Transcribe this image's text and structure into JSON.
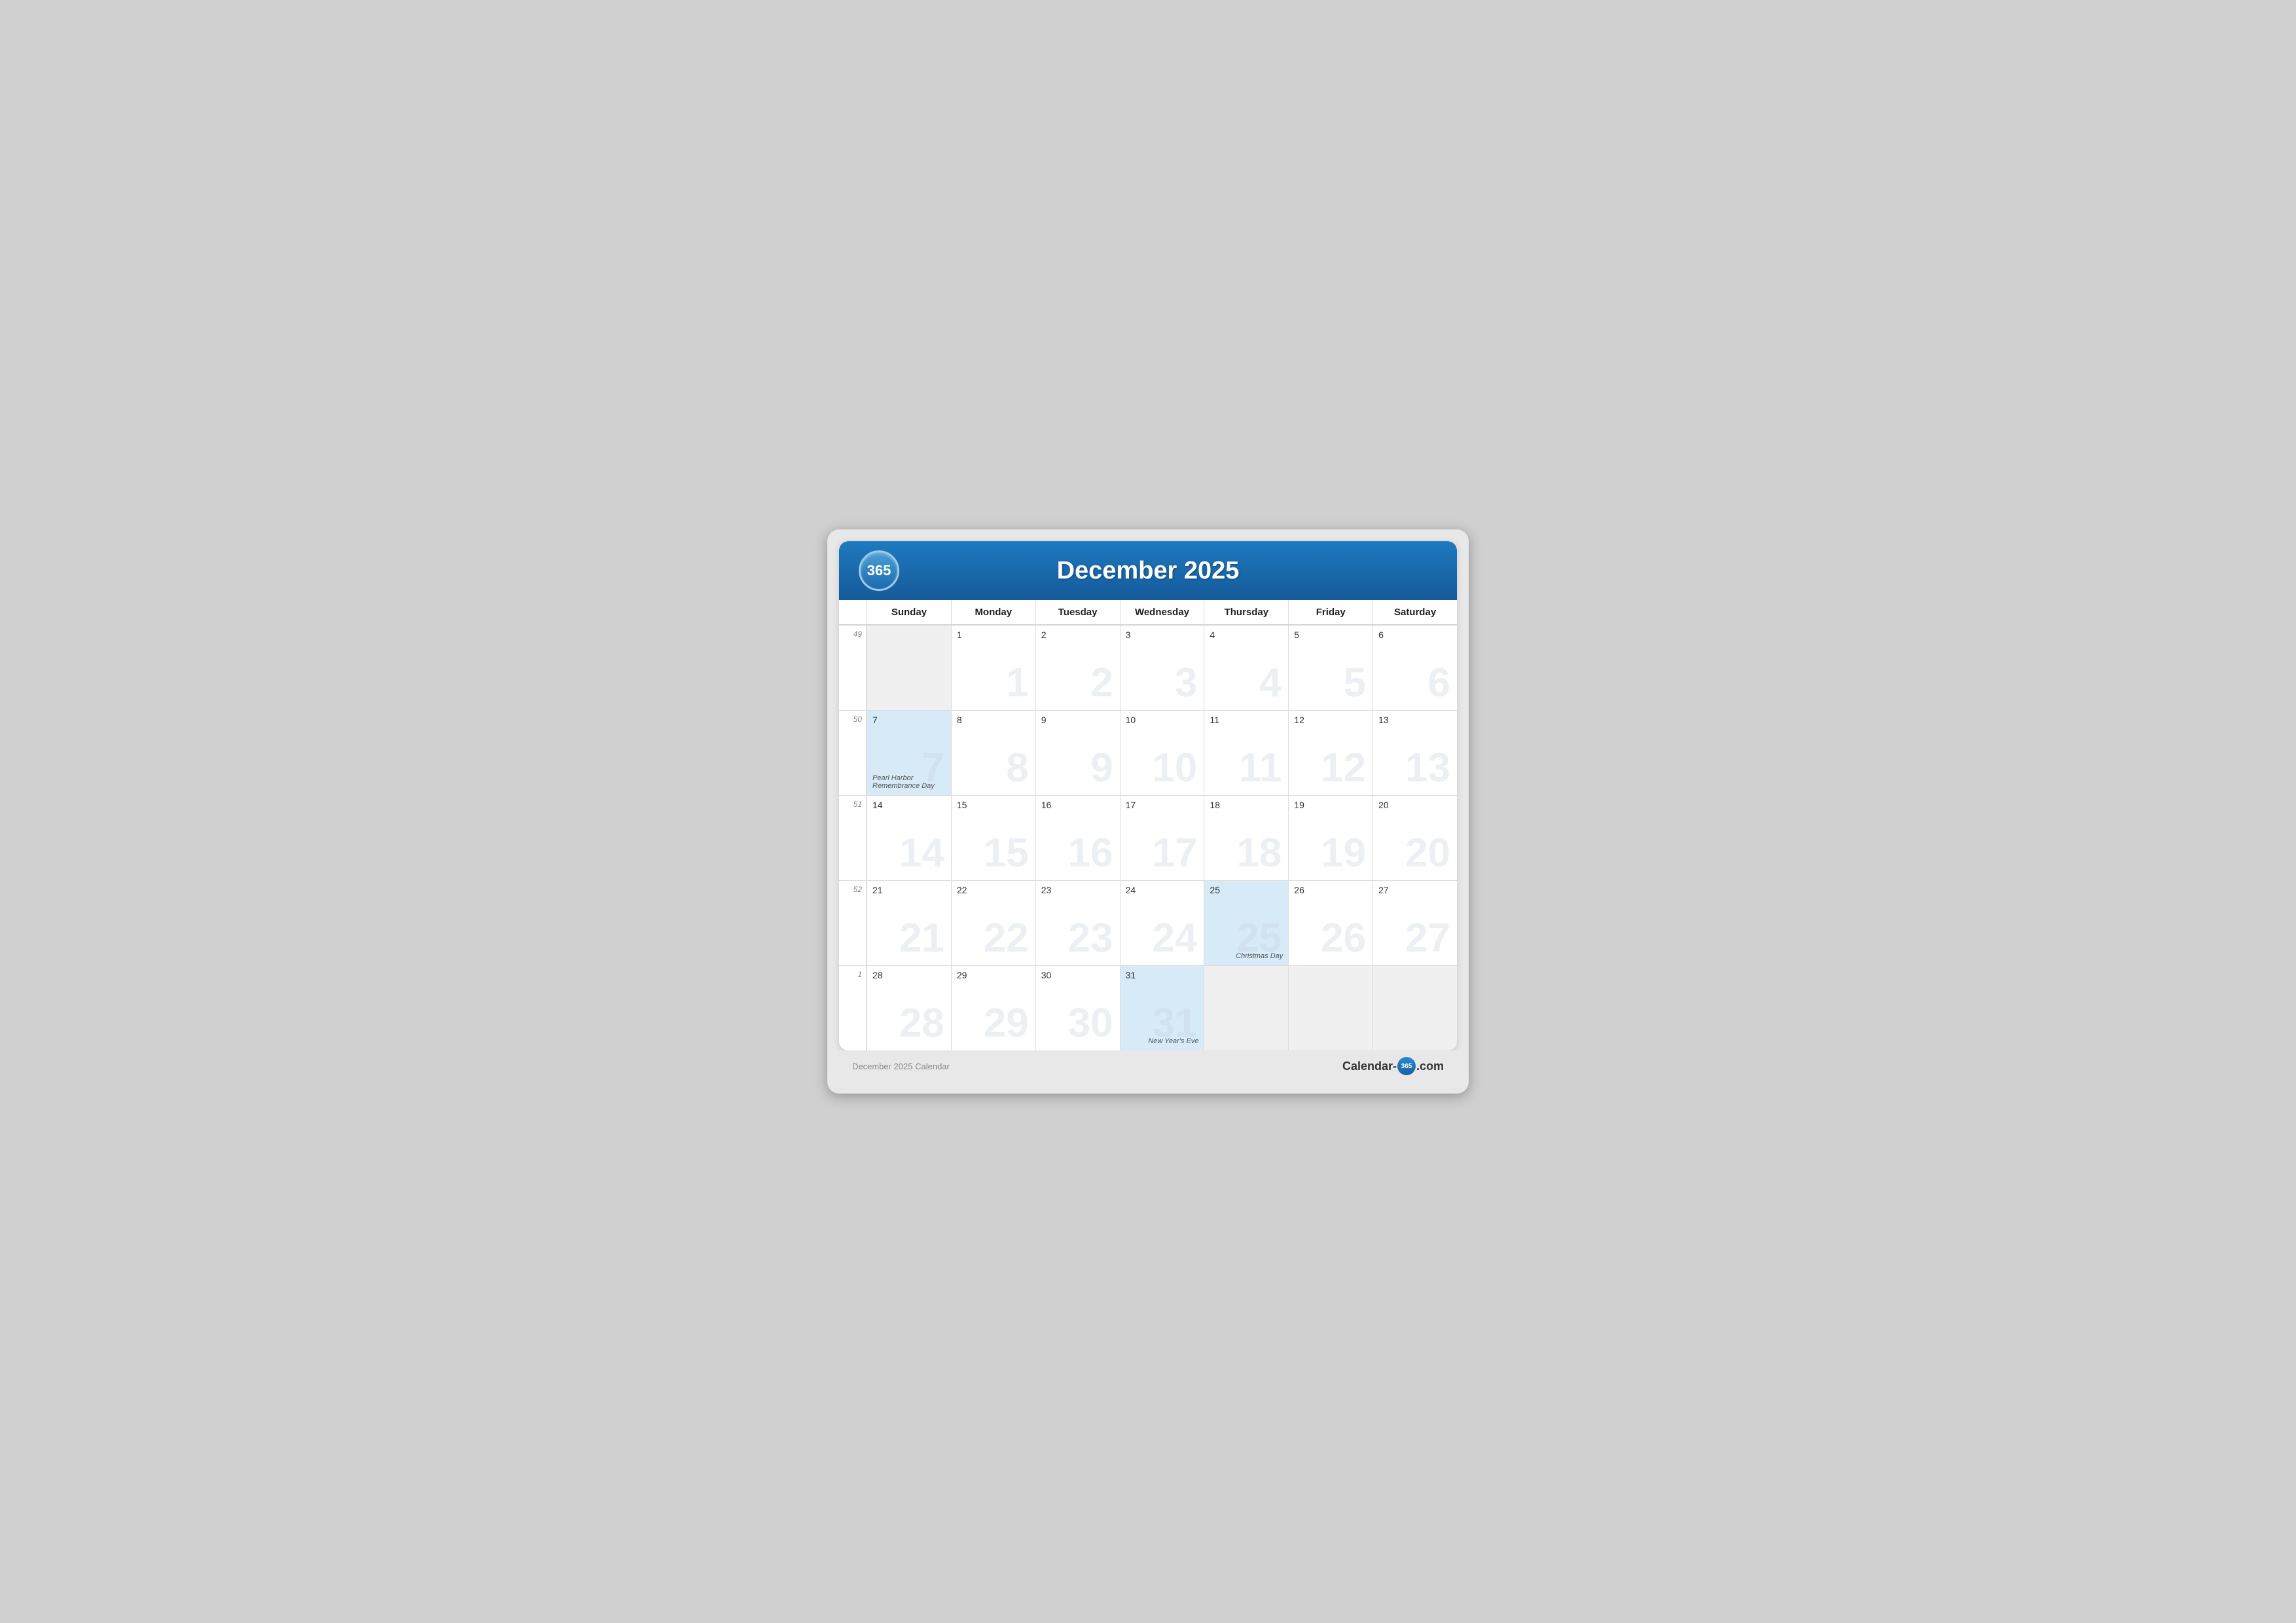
{
  "header": {
    "logo": "365",
    "title": "December 2025"
  },
  "days_of_week": [
    "Sunday",
    "Monday",
    "Tuesday",
    "Wednesday",
    "Thursday",
    "Friday",
    "Saturday"
  ],
  "weeks": [
    {
      "week_num": "49",
      "days": [
        {
          "date": "",
          "outside": true,
          "ghost": ""
        },
        {
          "date": "1",
          "outside": false,
          "ghost": "1"
        },
        {
          "date": "2",
          "outside": false,
          "ghost": "2"
        },
        {
          "date": "3",
          "outside": false,
          "ghost": "3"
        },
        {
          "date": "4",
          "outside": false,
          "ghost": "4"
        },
        {
          "date": "5",
          "outside": false,
          "ghost": "5"
        },
        {
          "date": "6",
          "outside": false,
          "ghost": "6"
        }
      ]
    },
    {
      "week_num": "50",
      "days": [
        {
          "date": "7",
          "outside": false,
          "ghost": "7",
          "highlighted": true,
          "holiday": "Pearl Harbor Remembrance Day",
          "holiday_pos": "left"
        },
        {
          "date": "8",
          "outside": false,
          "ghost": "8"
        },
        {
          "date": "9",
          "outside": false,
          "ghost": "9"
        },
        {
          "date": "10",
          "outside": false,
          "ghost": "10"
        },
        {
          "date": "11",
          "outside": false,
          "ghost": "11"
        },
        {
          "date": "12",
          "outside": false,
          "ghost": "12"
        },
        {
          "date": "13",
          "outside": false,
          "ghost": "13"
        }
      ]
    },
    {
      "week_num": "51",
      "days": [
        {
          "date": "14",
          "outside": false,
          "ghost": "14"
        },
        {
          "date": "15",
          "outside": false,
          "ghost": "15"
        },
        {
          "date": "16",
          "outside": false,
          "ghost": "16"
        },
        {
          "date": "17",
          "outside": false,
          "ghost": "17"
        },
        {
          "date": "18",
          "outside": false,
          "ghost": "18"
        },
        {
          "date": "19",
          "outside": false,
          "ghost": "19"
        },
        {
          "date": "20",
          "outside": false,
          "ghost": "20"
        }
      ]
    },
    {
      "week_num": "52",
      "days": [
        {
          "date": "21",
          "outside": false,
          "ghost": "21"
        },
        {
          "date": "22",
          "outside": false,
          "ghost": "22"
        },
        {
          "date": "23",
          "outside": false,
          "ghost": "23"
        },
        {
          "date": "24",
          "outside": false,
          "ghost": "24"
        },
        {
          "date": "25",
          "outside": false,
          "ghost": "25",
          "highlighted": true,
          "holiday": "Christmas Day",
          "holiday_pos": "right"
        },
        {
          "date": "26",
          "outside": false,
          "ghost": "26"
        },
        {
          "date": "27",
          "outside": false,
          "ghost": "27"
        }
      ]
    },
    {
      "week_num": "1",
      "days": [
        {
          "date": "28",
          "outside": false,
          "ghost": "28"
        },
        {
          "date": "29",
          "outside": false,
          "ghost": "29"
        },
        {
          "date": "30",
          "outside": false,
          "ghost": "30"
        },
        {
          "date": "31",
          "outside": false,
          "ghost": "31",
          "highlighted": true,
          "holiday": "New Year's Eve",
          "holiday_pos": "right"
        },
        {
          "date": "",
          "outside": true,
          "ghost": ""
        },
        {
          "date": "",
          "outside": true,
          "ghost": ""
        },
        {
          "date": "",
          "outside": true,
          "ghost": ""
        }
      ]
    }
  ],
  "footer": {
    "left": "December 2025 Calendar",
    "brand_pre": "Calendar-",
    "brand_365": "365",
    "brand_post": ".com"
  }
}
